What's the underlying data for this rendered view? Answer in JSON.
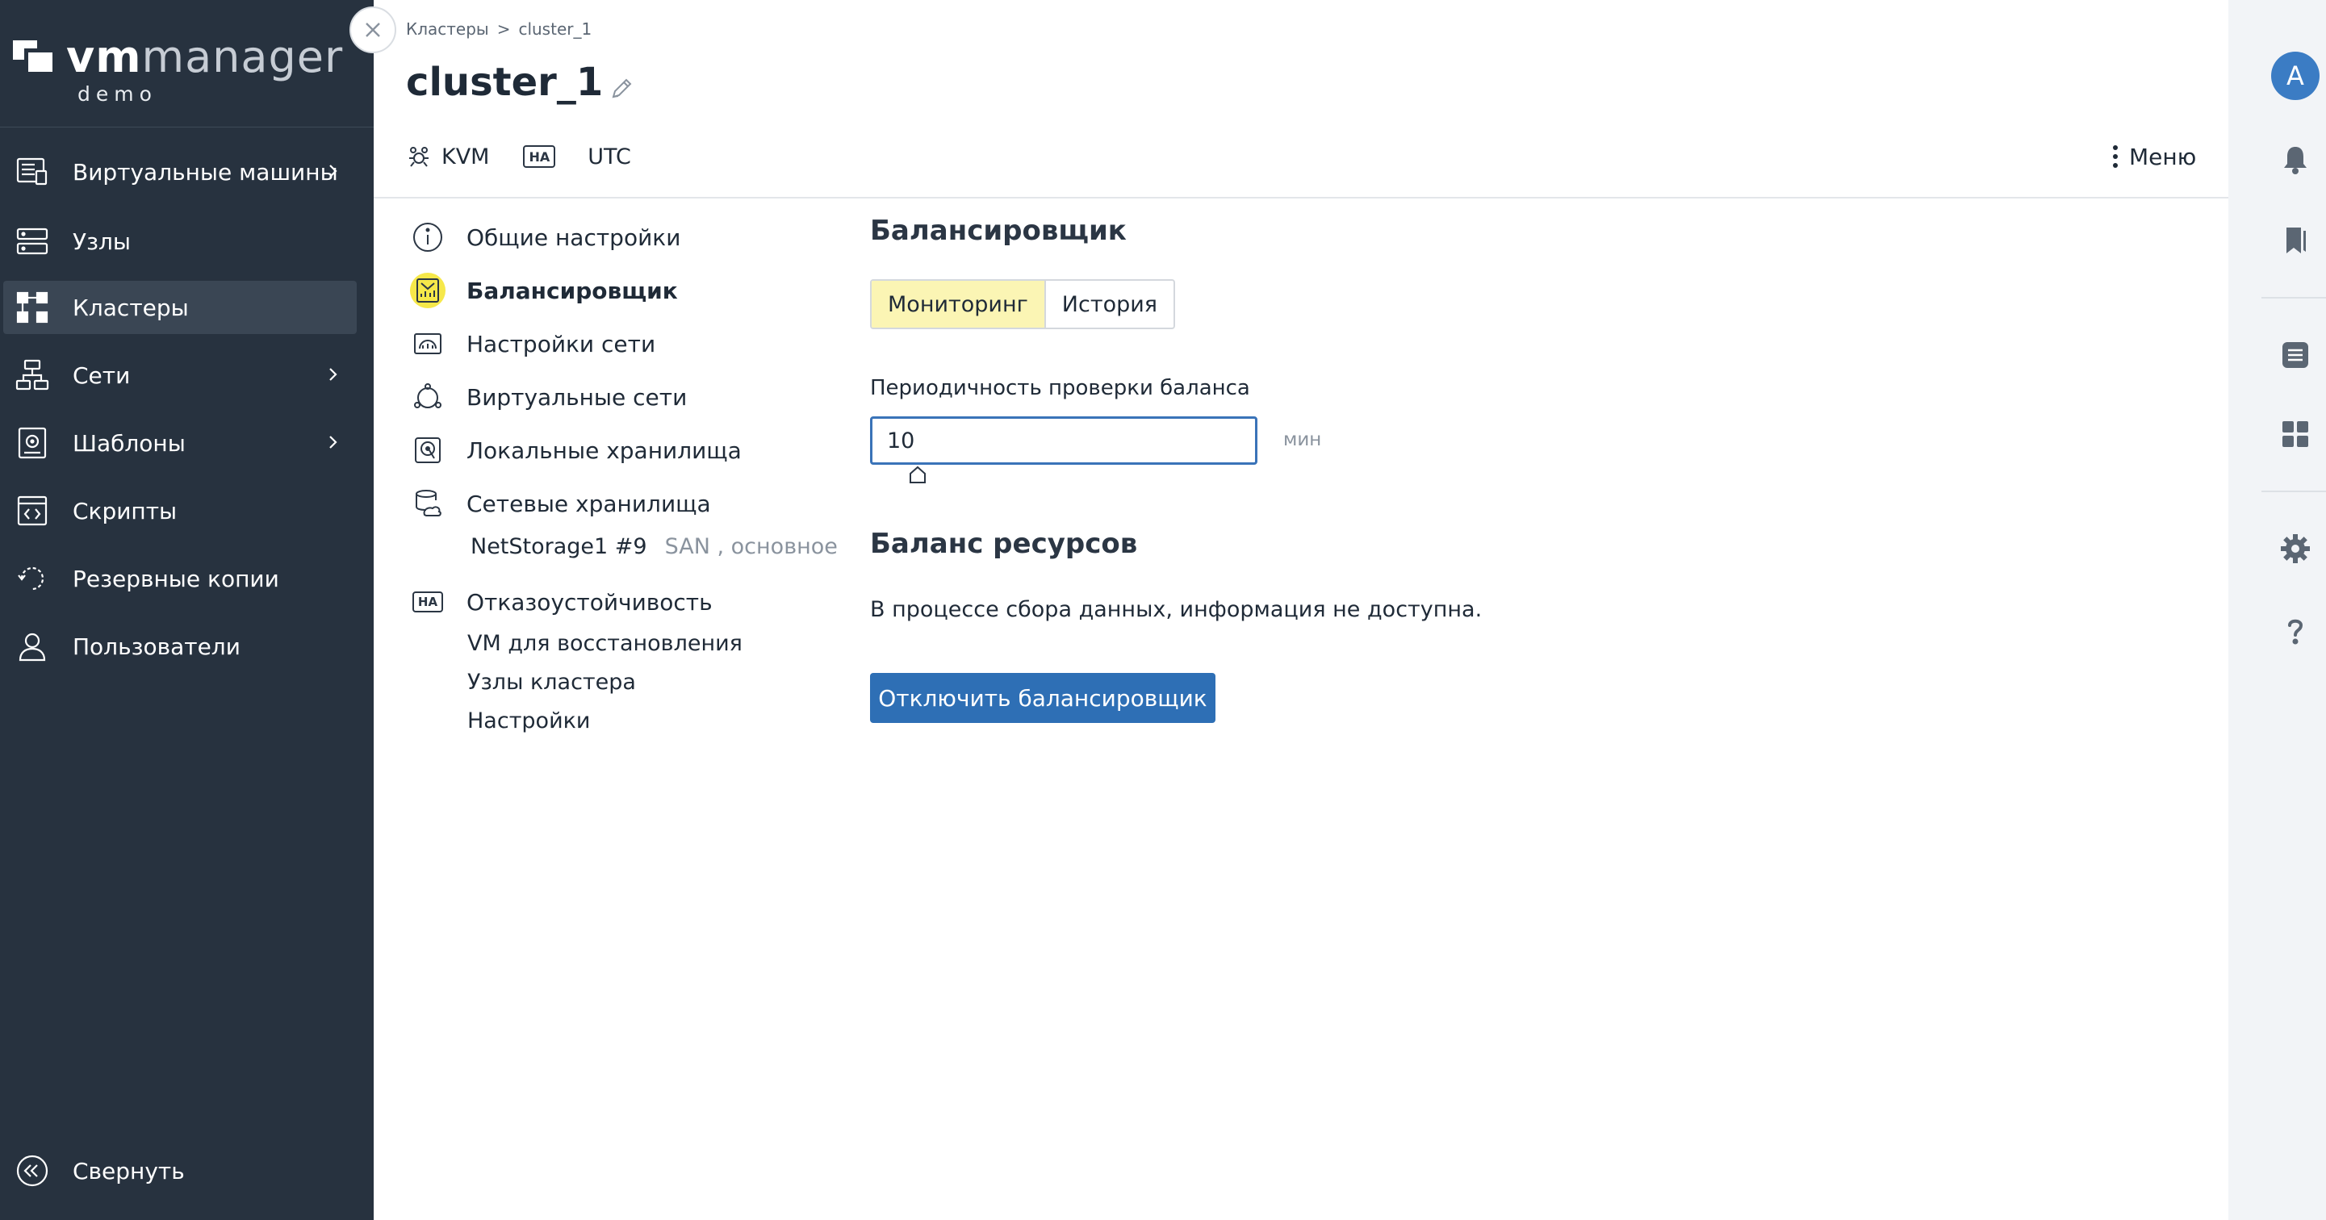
{
  "app": {
    "logo_brand": "vm",
    "logo_product": "manager",
    "logo_sub": "demo"
  },
  "sidebar": {
    "items": [
      {
        "label": "Виртуальные машины",
        "icon": "vm-icon",
        "has_chevron": true
      },
      {
        "label": "Узлы",
        "icon": "nodes-icon",
        "has_chevron": false
      },
      {
        "label": "Кластеры",
        "icon": "clusters-icon",
        "has_chevron": false,
        "active": true
      },
      {
        "label": "Сети",
        "icon": "networks-icon",
        "has_chevron": true
      },
      {
        "label": "Шаблоны",
        "icon": "templates-icon",
        "has_chevron": true
      },
      {
        "label": "Скрипты",
        "icon": "scripts-icon",
        "has_chevron": false
      },
      {
        "label": "Резервные копии",
        "icon": "backups-icon",
        "has_chevron": false
      },
      {
        "label": "Пользователи",
        "icon": "users-icon",
        "has_chevron": false
      }
    ],
    "collapse_label": "Свернуть"
  },
  "breadcrumb": {
    "parent": "Кластеры",
    "separator": ">",
    "current": "cluster_1"
  },
  "header": {
    "title": "cluster_1",
    "virtualization": "KVM",
    "ha_badge": "HA",
    "timezone": "UTC",
    "menu_label": "Меню"
  },
  "settings_nav": {
    "general": "Общие настройки",
    "balancer": "Балансировщик",
    "network_settings": "Настройки сети",
    "virtual_networks": "Виртуальные сети",
    "local_storages": "Локальные хранилища",
    "network_storages": "Сетевые хранилища",
    "storage_name": "NetStorage1 #9",
    "storage_type": "SAN , основное",
    "ha_icon_text": "HA",
    "failover": "Отказоустойчивость",
    "failover_vms": "VM для восстановления",
    "failover_nodes": "Узлы кластера",
    "failover_settings": "Настройки"
  },
  "content": {
    "balancer_title": "Балансировщик",
    "tabs": [
      "Мониторинг",
      "История"
    ],
    "active_tab": "Мониторинг",
    "period_label": "Периодичность проверки баланса",
    "period_value": "10",
    "period_unit": "мин",
    "balance_title": "Баланс ресурсов",
    "balance_info": "В процессе сбора данных, информация не доступна.",
    "disable_button": "Отключить балансировщик"
  },
  "rail": {
    "avatar_letter": "A"
  },
  "colors": {
    "sidebar_bg": "#27323f",
    "accent_blue": "#2e6fb5",
    "highlight_yellow": "#f6e84a",
    "active_tab_bg": "#fbf5b4"
  }
}
